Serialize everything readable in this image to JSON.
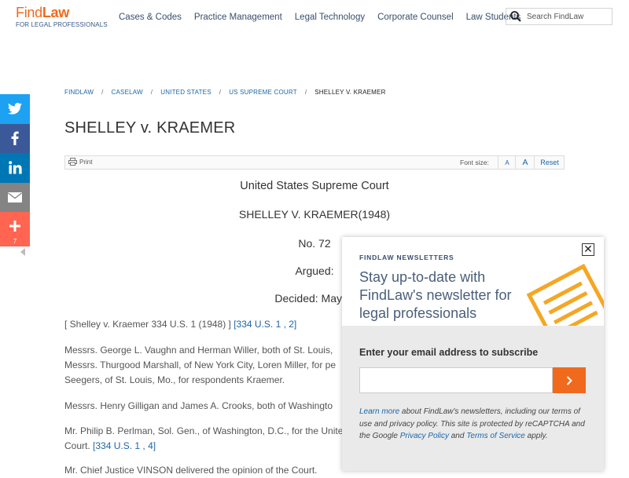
{
  "header": {
    "logo_brand_light": "Find",
    "logo_brand_bold": "Law",
    "logo_sub": "FOR LEGAL PROFESSIONALS",
    "nav": [
      "Cases & Codes",
      "Practice Management",
      "Legal Technology",
      "Corporate Counsel",
      "Law Students"
    ],
    "search_placeholder": "Search FindLaw"
  },
  "social": {
    "share_count": "7",
    "items": [
      "twitter-icon",
      "facebook-icon",
      "linkedin-icon",
      "email-icon",
      "plus-icon"
    ],
    "colors": {
      "twitter": "#1da1f2",
      "facebook": "#3b5998",
      "linkedin": "#0077b5",
      "email": "#848484",
      "plus": "#ff6550"
    }
  },
  "breadcrumb": {
    "items": [
      "FINDLAW",
      "CASELAW",
      "UNITED STATES",
      "US SUPREME COURT"
    ],
    "current": "SHELLEY V. KRAEMER",
    "separator": "/"
  },
  "page_title": "SHELLEY v. KRAEMER",
  "toolbar": {
    "print": "Print",
    "font_size_label": "Font size:",
    "small_a": "A",
    "large_a": "A",
    "reset": "Reset"
  },
  "opinion": {
    "court": "United States Supreme Court",
    "case": "SHELLEY V. KRAEMER(1948)",
    "number": "No. 72",
    "argued": "Argued:",
    "decided": "Decided: May 3,",
    "citation_text": "[ Shelley v. Kraemer 334 U.S. 1 (1948) ]",
    "citation_link": "[334 U.S. 1 , 2]",
    "p1_line1": "Messrs. George L. Vaughn and Herman Willer, both of St. Louis,",
    "p1_line2": "Messrs. Thurgood Marshall, of New York City, Loren Miller, for pe",
    "p1_line3": "Seegers, of St. Louis, Mo., for respondents Kraemer.",
    "p2": "Messrs. Henry Gilligan and James A. Crooks, both of Washingto",
    "p3_line1": "Mr. Philip B. Perlman, Sol. Gen., of Washington, D.C., for the Unite",
    "p3_line2": "Court.",
    "p3_link": "[334 U.S. 1 , 4]",
    "p4": "Mr. Chief Justice VINSON delivered the opinion of the Court."
  },
  "newsletter": {
    "kicker": "FINDLAW NEWSLETTERS",
    "headline": "Stay up-to-date with FindLaw's newsletter for legal professionals",
    "email_label": "Enter your email address to subscribe",
    "email_value": "",
    "fine_link1": "Learn more",
    "fine_text1": " about FindLaw's newsletters, including our terms of use and privacy policy. This site is protected by reCAPTCHA and the Google ",
    "fine_link2": "Privacy Policy",
    "fine_text2": " and ",
    "fine_link3": "Terms of Service",
    "fine_text3": " apply.",
    "accent_color": "#f06a1d"
  }
}
